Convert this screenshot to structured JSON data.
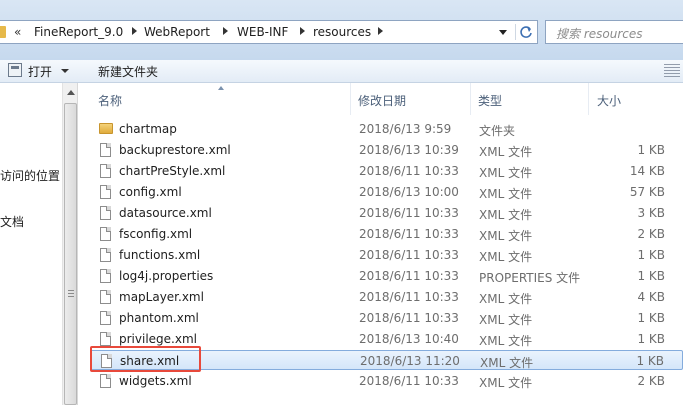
{
  "address": {
    "back_chevrons": "«",
    "breadcrumbs": [
      "FineReport_9.0",
      "WebReport",
      "WEB-INF",
      "resources"
    ]
  },
  "search": {
    "placeholder": "搜索 resources"
  },
  "toolbar": {
    "open_label": "打开",
    "new_folder_label": "新建文件夹"
  },
  "nav": {
    "items": [
      "访问的位置",
      "文档"
    ]
  },
  "columns": {
    "name": "名称",
    "date": "修改日期",
    "type": "类型",
    "size": "大小"
  },
  "files": [
    {
      "name": "chartmap",
      "date": "2018/6/13 9:59",
      "type": "文件夹",
      "size": "",
      "icon": "folder-icon"
    },
    {
      "name": "backuprestore.xml",
      "date": "2018/6/13 10:39",
      "type": "XML 文件",
      "size": "1 KB",
      "icon": "file-icon"
    },
    {
      "name": "chartPreStyle.xml",
      "date": "2018/6/11 10:33",
      "type": "XML 文件",
      "size": "14 KB",
      "icon": "file-icon"
    },
    {
      "name": "config.xml",
      "date": "2018/6/13 10:00",
      "type": "XML 文件",
      "size": "57 KB",
      "icon": "file-icon"
    },
    {
      "name": "datasource.xml",
      "date": "2018/6/11 10:33",
      "type": "XML 文件",
      "size": "3 KB",
      "icon": "file-icon"
    },
    {
      "name": "fsconfig.xml",
      "date": "2018/6/11 10:33",
      "type": "XML 文件",
      "size": "2 KB",
      "icon": "file-icon"
    },
    {
      "name": "functions.xml",
      "date": "2018/6/11 10:33",
      "type": "XML 文件",
      "size": "1 KB",
      "icon": "file-icon"
    },
    {
      "name": "log4j.properties",
      "date": "2018/6/11 10:33",
      "type": "PROPERTIES 文件",
      "size": "1 KB",
      "icon": "file-icon"
    },
    {
      "name": "mapLayer.xml",
      "date": "2018/6/11 10:33",
      "type": "XML 文件",
      "size": "4 KB",
      "icon": "file-icon"
    },
    {
      "name": "phantom.xml",
      "date": "2018/6/11 10:33",
      "type": "XML 文件",
      "size": "1 KB",
      "icon": "file-icon"
    },
    {
      "name": "privilege.xml",
      "date": "2018/6/13 10:40",
      "type": "XML 文件",
      "size": "1 KB",
      "icon": "file-icon"
    },
    {
      "name": "share.xml",
      "date": "2018/6/13 11:20",
      "type": "XML 文件",
      "size": "1 KB",
      "icon": "file-icon",
      "selected": true
    },
    {
      "name": "widgets.xml",
      "date": "2018/6/11 10:33",
      "type": "XML 文件",
      "size": "2 KB",
      "icon": "file-icon"
    }
  ],
  "colors": {
    "selection": "#d4e6fa",
    "highlight_annotation": "#e8493b",
    "folder": "#e0ac3c"
  }
}
